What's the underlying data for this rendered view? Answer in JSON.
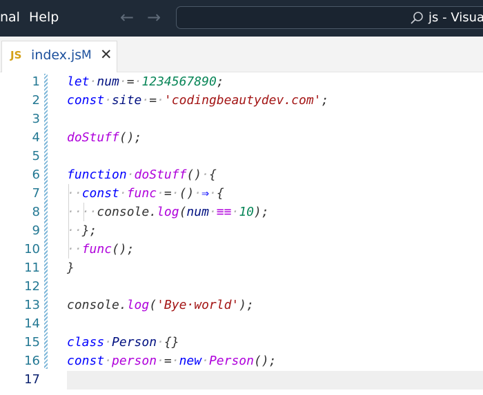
{
  "titlebar": {
    "menu_partial": "nal",
    "menu_help": "Help",
    "back_arrow": "←",
    "forward_arrow": "→",
    "command_center_text": "js - Visual"
  },
  "tab": {
    "icon_text": "JS",
    "filename": "index.js",
    "modified_badge": "M",
    "close_glyph": "✕"
  },
  "editor": {
    "active_line": 17,
    "line_numbers": [
      "1",
      "2",
      "3",
      "4",
      "5",
      "6",
      "7",
      "8",
      "9",
      "10",
      "11",
      "12",
      "13",
      "14",
      "15",
      "16",
      "17"
    ],
    "lines": [
      [
        {
          "t": "let",
          "c": "kw"
        },
        {
          "t": "·",
          "c": "dot"
        },
        {
          "t": "num",
          "c": "var"
        },
        {
          "t": "·",
          "c": "dot"
        },
        {
          "t": "=",
          "c": "op"
        },
        {
          "t": "·",
          "c": "dot"
        },
        {
          "t": "1234567890",
          "c": "num"
        },
        {
          "t": ";",
          "c": "plain"
        }
      ],
      [
        {
          "t": "const",
          "c": "kw"
        },
        {
          "t": "·",
          "c": "dot"
        },
        {
          "t": "site",
          "c": "var"
        },
        {
          "t": "·",
          "c": "dot"
        },
        {
          "t": "=",
          "c": "op"
        },
        {
          "t": "·",
          "c": "dot"
        },
        {
          "t": "'codingbeautydev.com'",
          "c": "str"
        },
        {
          "t": ";",
          "c": "plain"
        }
      ],
      [],
      [
        {
          "t": "doStuff",
          "c": "fn"
        },
        {
          "t": "();",
          "c": "plain"
        }
      ],
      [],
      [
        {
          "t": "function",
          "c": "kw"
        },
        {
          "t": "·",
          "c": "dot"
        },
        {
          "t": "doStuff",
          "c": "fn"
        },
        {
          "t": "()",
          "c": "plain"
        },
        {
          "t": "·",
          "c": "dot"
        },
        {
          "t": "{",
          "c": "plain"
        }
      ],
      [
        {
          "t": "··",
          "c": "dot"
        },
        {
          "t": "const",
          "c": "kw"
        },
        {
          "t": "·",
          "c": "dot"
        },
        {
          "t": "func",
          "c": "fn"
        },
        {
          "t": "·",
          "c": "dot"
        },
        {
          "t": "=",
          "c": "op"
        },
        {
          "t": "·",
          "c": "dot"
        },
        {
          "t": "()",
          "c": "plain"
        },
        {
          "t": "·",
          "c": "dot"
        },
        {
          "t": "⇒",
          "c": "kw"
        },
        {
          "t": "·",
          "c": "dot"
        },
        {
          "t": "{",
          "c": "plain"
        }
      ],
      [
        {
          "t": "····",
          "c": "dot"
        },
        {
          "t": "console",
          "c": "tokplain"
        },
        {
          "t": ".",
          "c": "plain"
        },
        {
          "t": "log",
          "c": "fn"
        },
        {
          "t": "(",
          "c": "plain"
        },
        {
          "t": "num",
          "c": "var"
        },
        {
          "t": "·",
          "c": "dot"
        },
        {
          "t": "≡≡",
          "c": "fn"
        },
        {
          "t": "·",
          "c": "dot"
        },
        {
          "t": "10",
          "c": "num"
        },
        {
          "t": ");",
          "c": "plain"
        }
      ],
      [
        {
          "t": "··",
          "c": "dot"
        },
        {
          "t": "};",
          "c": "plain"
        }
      ],
      [
        {
          "t": "··",
          "c": "dot"
        },
        {
          "t": "func",
          "c": "fn"
        },
        {
          "t": "();",
          "c": "plain"
        }
      ],
      [
        {
          "t": "}",
          "c": "plain"
        }
      ],
      [],
      [
        {
          "t": "console",
          "c": "tokplain"
        },
        {
          "t": ".",
          "c": "plain"
        },
        {
          "t": "log",
          "c": "fn"
        },
        {
          "t": "(",
          "c": "plain"
        },
        {
          "t": "'Bye·world'",
          "c": "str"
        },
        {
          "t": ");",
          "c": "plain"
        }
      ],
      [],
      [
        {
          "t": "class",
          "c": "kw"
        },
        {
          "t": "·",
          "c": "dot"
        },
        {
          "t": "Person",
          "c": "var"
        },
        {
          "t": "·",
          "c": "dot"
        },
        {
          "t": "{}",
          "c": "plain"
        }
      ],
      [
        {
          "t": "const",
          "c": "kw"
        },
        {
          "t": "·",
          "c": "dot"
        },
        {
          "t": "person",
          "c": "fn"
        },
        {
          "t": "·",
          "c": "dot"
        },
        {
          "t": "=",
          "c": "op"
        },
        {
          "t": "·",
          "c": "dot"
        },
        {
          "t": "new",
          "c": "kw"
        },
        {
          "t": "·",
          "c": "dot"
        },
        {
          "t": "Person",
          "c": "fn"
        },
        {
          "t": "();",
          "c": "plain"
        }
      ],
      []
    ]
  },
  "colors": {
    "titlebar_bg": "#1f2a37",
    "keyword": "#0000ff",
    "variable": "#001080",
    "function": "#af00db",
    "number": "#098658",
    "string": "#a31515",
    "line_number": "#237893",
    "active_line_number": "#0b216f"
  }
}
